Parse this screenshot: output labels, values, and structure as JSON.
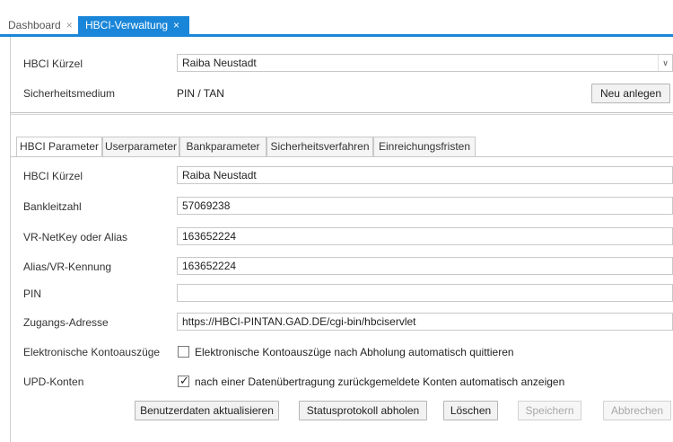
{
  "tabs": [
    {
      "label": "Dashboard",
      "close": "×"
    },
    {
      "label": "HBCI-Verwaltung",
      "close": "×"
    }
  ],
  "header": {
    "kuerzel_label": "HBCI Kürzel",
    "kuerzel_value": "Raiba Neustadt",
    "dropdown_arrow": "∨",
    "medium_label": "Sicherheitsmedium",
    "medium_value": "PIN / TAN",
    "new_button": "Neu anlegen"
  },
  "inner_tabs": [
    "HBCI Parameter",
    "Userparameter",
    "Bankparameter",
    "Sicherheitsverfahren",
    "Einreichungsfristen"
  ],
  "form": {
    "kuerzel": {
      "label": "HBCI Kürzel",
      "value": "Raiba Neustadt"
    },
    "blz": {
      "label": "Bankleitzahl",
      "value": "57069238"
    },
    "netkey": {
      "label": "VR-NetKey oder Alias",
      "value": "163652224"
    },
    "alias": {
      "label": "Alias/VR-Kennung",
      "value": "163652224"
    },
    "pin": {
      "label": "PIN",
      "value": ""
    },
    "address": {
      "label": "Zugangs-Adresse",
      "value": "https://HBCI-PINTAN.GAD.DE/cgi-bin/hbciservlet"
    },
    "ekonto": {
      "label": "Elektronische Kontoauszüge",
      "text": "Elektronische Kontoauszüge nach Abholung automatisch quittieren",
      "checked": false
    },
    "upd": {
      "label": "UPD-Konten",
      "text": "nach einer Datenübertragung zurückgemeldete Konten automatisch anzeigen",
      "checked": true,
      "mark": "✓"
    }
  },
  "buttons": {
    "update": "Benutzerdaten aktualisieren",
    "status": "Statusprotokoll abholen",
    "delete": "Löschen",
    "save": "Speichern",
    "cancel": "Abbrechen"
  }
}
